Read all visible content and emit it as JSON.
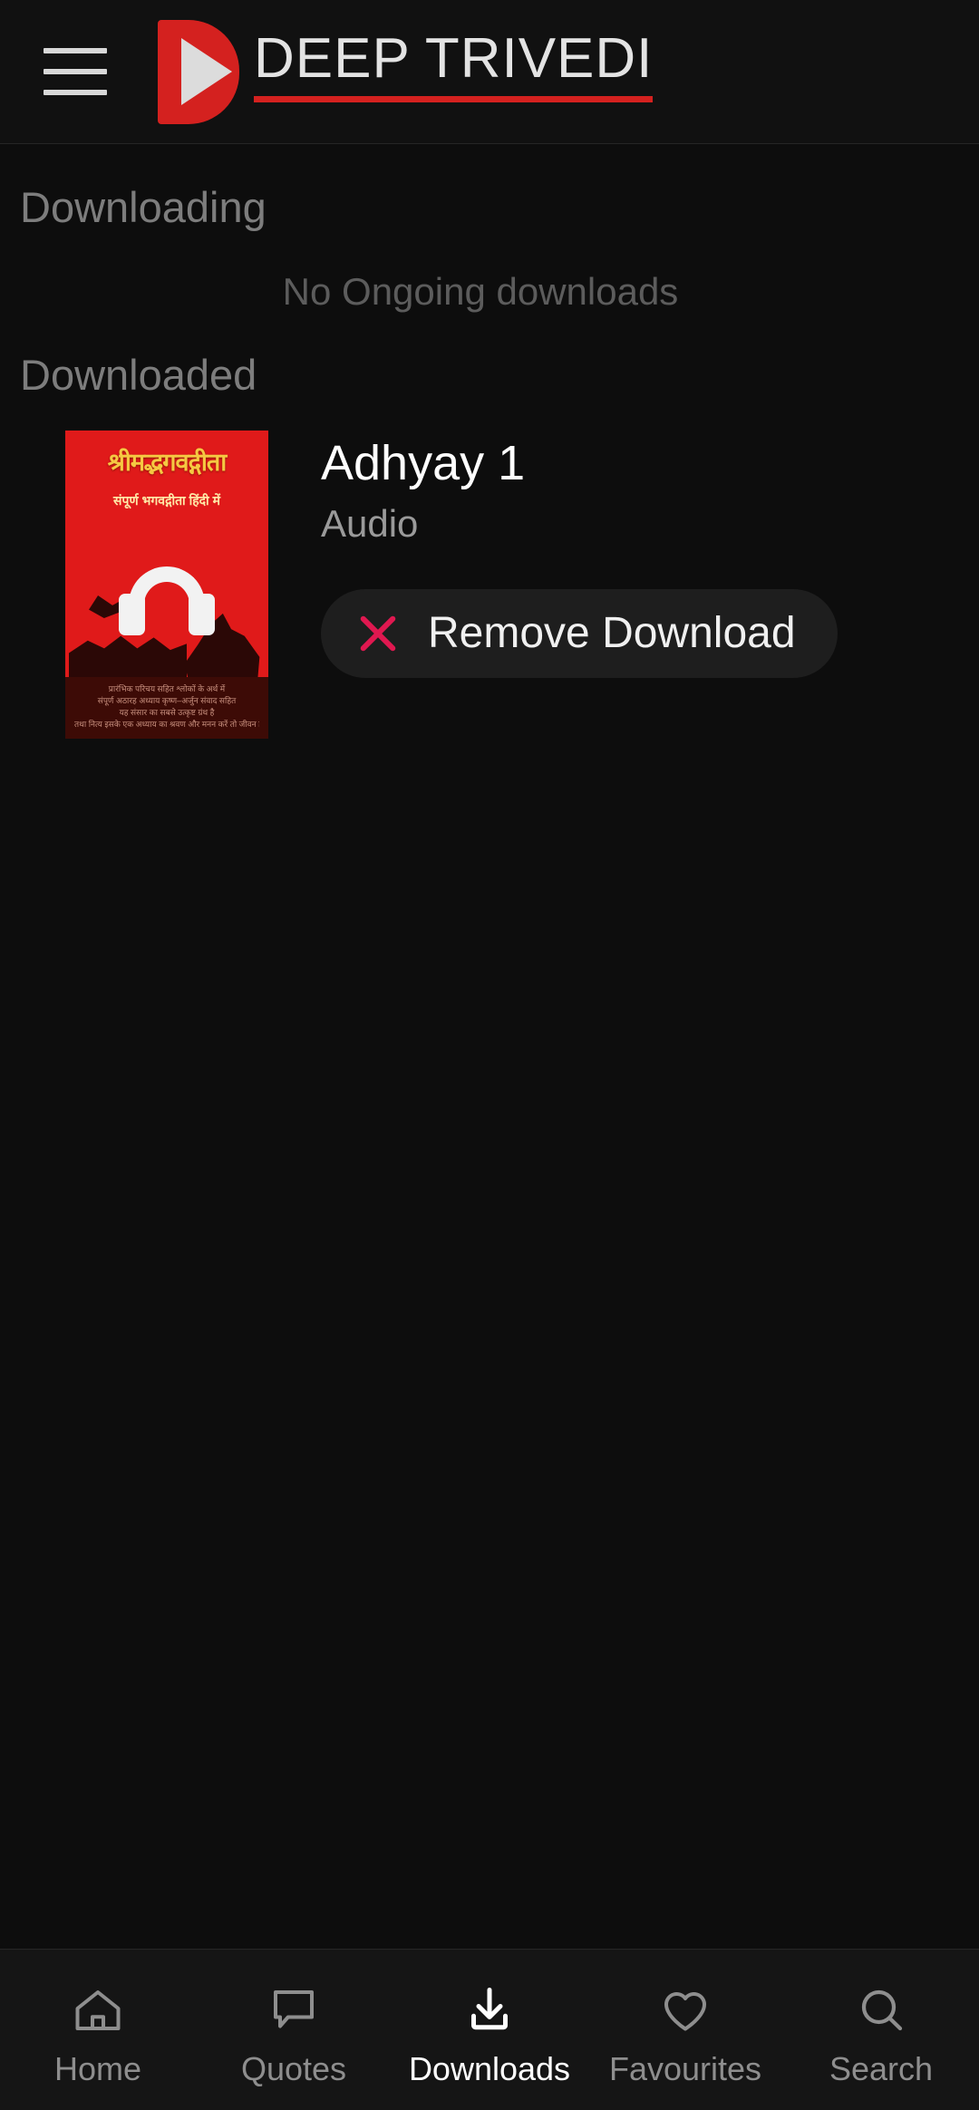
{
  "header": {
    "menu_icon": "hamburger-menu-icon",
    "logo_icon": "play-logo-icon",
    "brand_title": "DEEP TRIVEDI",
    "accent_color": "#d4211f"
  },
  "content": {
    "downloading_heading": "Downloading",
    "downloading_empty": "No Ongoing downloads",
    "downloaded_heading": "Downloaded",
    "item": {
      "title": "Adhyay 1",
      "type": "Audio",
      "remove_label": "Remove Download",
      "remove_icon": "close-x-icon",
      "remove_icon_color": "#e01850",
      "thumbnail": {
        "alt": "album-art-shrimad-bhagavad-gita",
        "background_color": "#e01a1a",
        "title_text": "श्रीमद्भगवद्गीता",
        "subtitle_text": "संपूर्ण भगवद्गीता हिंदी में",
        "overlay_icon": "headphones-icon",
        "footer_lines": [
          "प्रारंभिक परिचय सहित श्लोकों के अर्थ में",
          "संपूर्ण अठारह अध्याय कृष्ण–अर्जुन संवाद सहित",
          "यह संसार का सबसे उत्कृष्ट ग्रंथ है",
          "तथा नित्य इसके एक अध्याय का श्रवण और मनन करें तो जीवन है"
        ]
      }
    }
  },
  "bottom_nav": {
    "items": [
      {
        "label": "Home",
        "icon": "home-icon",
        "active": false
      },
      {
        "label": "Quotes",
        "icon": "chat-icon",
        "active": false
      },
      {
        "label": "Downloads",
        "icon": "download-icon",
        "active": true
      },
      {
        "label": "Favourites",
        "icon": "heart-icon",
        "active": false
      },
      {
        "label": "Search",
        "icon": "search-icon",
        "active": false
      }
    ]
  }
}
